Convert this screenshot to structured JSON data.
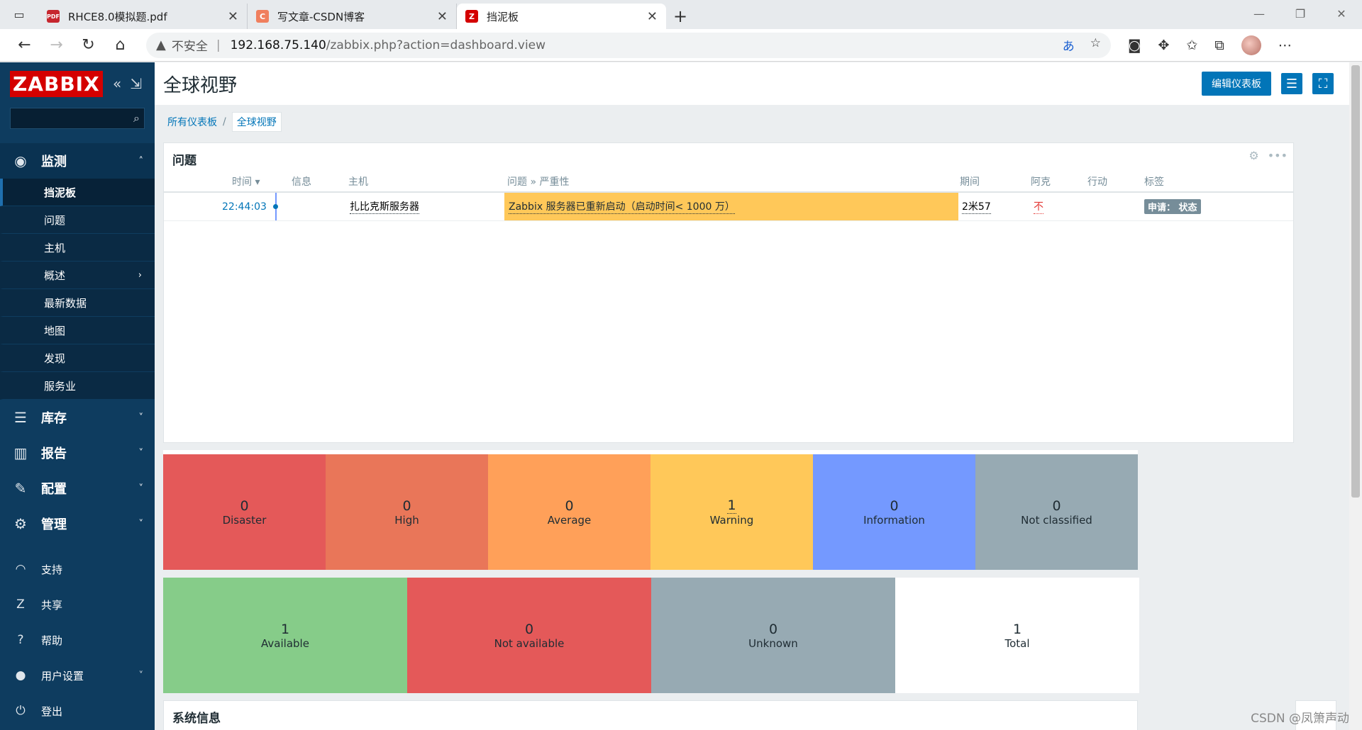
{
  "browser": {
    "tabs": [
      {
        "title": "RHCE8.0模拟题.pdf",
        "favicon": "PDF",
        "favicon_color": "#c6262e",
        "active": false
      },
      {
        "title": "写文章-CSDN博客",
        "favicon": "C",
        "favicon_color": "#f07f5e",
        "active": false
      },
      {
        "title": "挡泥板",
        "favicon": "Z",
        "favicon_color": "#d40000",
        "active": true
      }
    ],
    "new_tab": "+",
    "address": {
      "insecure_label": "不安全",
      "host": "192.168.75.140",
      "path": "/zabbix.php?action=dashboard.view"
    }
  },
  "sidebar": {
    "logo": "ZABBIX",
    "search_placeholder": "",
    "monitoring": {
      "label": "监测",
      "items": [
        {
          "label": "挡泥板",
          "active": true,
          "has_arrow": false
        },
        {
          "label": "问题",
          "active": false,
          "has_arrow": false
        },
        {
          "label": "主机",
          "active": false,
          "has_arrow": false
        },
        {
          "label": "概述",
          "active": false,
          "has_arrow": true
        },
        {
          "label": "最新数据",
          "active": false,
          "has_arrow": false
        },
        {
          "label": "地图",
          "active": false,
          "has_arrow": false
        },
        {
          "label": "发现",
          "active": false,
          "has_arrow": false
        },
        {
          "label": "服务业",
          "active": false,
          "has_arrow": false
        }
      ]
    },
    "inventory": "库存",
    "reports": "报告",
    "configuration": "配置",
    "administration": "管理",
    "support": "支持",
    "share": "共享",
    "help": "帮助",
    "user_settings": "用户设置",
    "logout": "登出"
  },
  "header": {
    "title": "全球视野",
    "edit_button": "编辑仪表板"
  },
  "breadcrumb": {
    "all": "所有仪表板",
    "sep": "/",
    "current": "全球视野"
  },
  "problems_widget": {
    "title": "问题",
    "columns": {
      "time": "时间 ▾",
      "info": "信息",
      "host": "主机",
      "problem": "问题 » 严重性",
      "duration": "期间",
      "ack": "阿克",
      "actions": "行动",
      "tags": "标签"
    },
    "rows": [
      {
        "time": "22:44:03",
        "host": "扎比克斯服务器",
        "problem": "Zabbix 服务器已重新启动（启动时间< 1000 万）",
        "duration": "2米57",
        "ack": "不",
        "tag": "申请：  状态",
        "severity_color": "#ffc859"
      }
    ]
  },
  "severity_widget": {
    "boxes": [
      {
        "count": "0",
        "label": "Disaster",
        "color": "#e45959"
      },
      {
        "count": "0",
        "label": "High",
        "color": "#e97659"
      },
      {
        "count": "0",
        "label": "Average",
        "color": "#ffa059"
      },
      {
        "count": "1",
        "label": "Warning",
        "color": "#ffc859"
      },
      {
        "count": "0",
        "label": "Information",
        "color": "#7499ff"
      },
      {
        "count": "0",
        "label": "Not classified",
        "color": "#97aab3"
      }
    ]
  },
  "availability_widget": {
    "boxes": [
      {
        "count": "1",
        "label": "Available",
        "color": "#86cc89"
      },
      {
        "count": "0",
        "label": "Not available",
        "color": "#e45959"
      },
      {
        "count": "0",
        "label": "Unknown",
        "color": "#97aab3"
      },
      {
        "count": "1",
        "label": "Total",
        "color": "#ffffff"
      }
    ]
  },
  "system_info_widget": {
    "title": "系统信息"
  },
  "watermark": "CSDN @凤箫声动"
}
